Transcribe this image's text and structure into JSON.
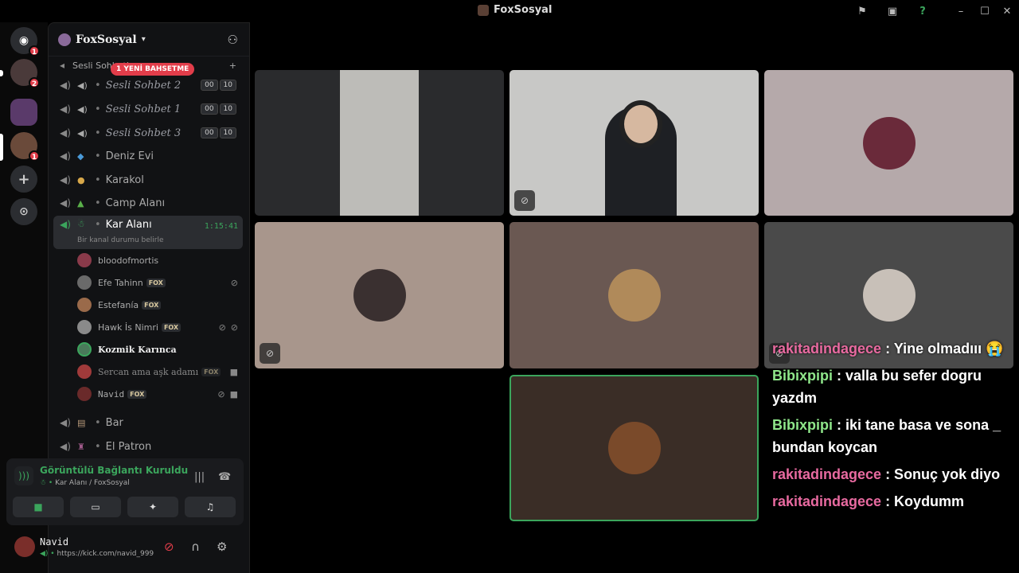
{
  "window": {
    "title": "FoxSosyal"
  },
  "servers": {
    "badges": [
      "1",
      "2",
      "1"
    ]
  },
  "guild": {
    "name": "FoxSosyal",
    "mention_banner": "1 YENİ BAHSETME"
  },
  "category": {
    "label": "Sesli Sohbetler"
  },
  "channels": [
    {
      "name": "Sesli Sohbet 2",
      "tags": [
        "00",
        "10"
      ]
    },
    {
      "name": "Sesli Sohbet 1",
      "tags": [
        "00",
        "10"
      ]
    },
    {
      "name": "Sesli Sohbet 3",
      "tags": [
        "00",
        "10"
      ]
    },
    {
      "name": "Deniz Evi"
    },
    {
      "name": "Karakol"
    },
    {
      "name": "Camp Alanı"
    }
  ],
  "active_channel": {
    "name": "Kar Alanı",
    "timer": "1:15:41",
    "status": "Bir kanal durumu belirle"
  },
  "members": [
    {
      "name": "bloodofmortis",
      "tag": ""
    },
    {
      "name": "Efe Tahinn",
      "tag": "FOX"
    },
    {
      "name": "Estefanía",
      "tag": "FOX"
    },
    {
      "name": "Hawk İs Nimri",
      "tag": "FOX"
    },
    {
      "name": "Kozmik Karınca",
      "tag": ""
    },
    {
      "name": "Sercan ama aşk adamı",
      "tag": "FOX"
    },
    {
      "name": "Navid",
      "tag": "FOX"
    }
  ],
  "more_channels": [
    {
      "name": "Bar"
    },
    {
      "name": "El Patron"
    }
  ],
  "voice": {
    "title": "Görüntülü Bağlantı Kuruldu",
    "subtitle": "Kar Alanı / FoxSosyal"
  },
  "user": {
    "name": "Navid",
    "status": "https://kick.com/navid_999"
  },
  "chat": [
    {
      "user": "rakitadindagece",
      "text": " : Yine olmadııı 😭",
      "color": "pink"
    },
    {
      "user": "Bibixpipi",
      "text": " : valla bu sefer dogru yazdm",
      "color": "green"
    },
    {
      "user": "Bibixpipi",
      "text": " : iki tane basa ve sona _ bundan koycan",
      "color": "green"
    },
    {
      "user": "rakitadindagece",
      "text": " : Sonuç yok diyo",
      "color": "pink"
    },
    {
      "user": "rakitadindagece",
      "text": " : Koydumm",
      "color": "pink"
    }
  ]
}
